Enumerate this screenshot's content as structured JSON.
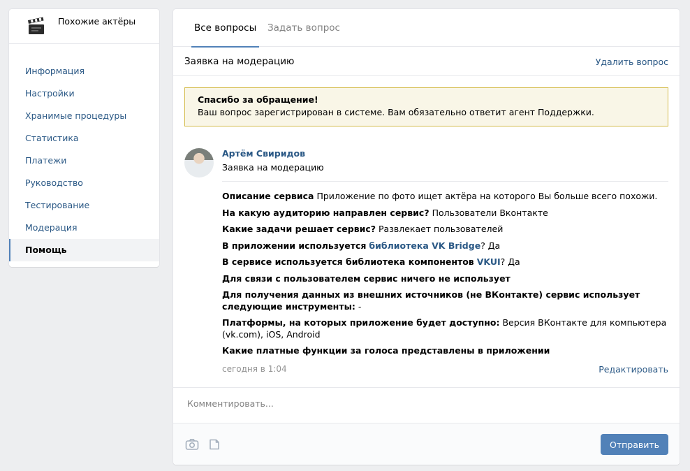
{
  "app": {
    "name": "Похожие актёры",
    "icon": "clapperboard-icon"
  },
  "sidebar": {
    "items": [
      {
        "label": "Информация"
      },
      {
        "label": "Настройки"
      },
      {
        "label": "Хранимые процедуры"
      },
      {
        "label": "Статистика"
      },
      {
        "label": "Платежи"
      },
      {
        "label": "Руководство"
      },
      {
        "label": "Тестирование"
      },
      {
        "label": "Модерация"
      },
      {
        "label": "Помощь",
        "active": true
      }
    ]
  },
  "tabs": [
    {
      "label": "Все вопросы",
      "active": true
    },
    {
      "label": "Задать вопрос"
    }
  ],
  "ticket": {
    "title": "Заявка на модерацию",
    "delete_label": "Удалить вопрос"
  },
  "notice": {
    "title": "Спасибо за обращение!",
    "text": "Ваш вопрос зарегистрирован в системе. Вам обязательно ответит агент Поддержки."
  },
  "message": {
    "author": "Артём Свиридов",
    "subject": "Заявка на модерацию",
    "fields": [
      {
        "label": "Описание сервиса",
        "value": "Приложение по фото ищет актёра на которого Вы больше всего похожи."
      },
      {
        "label": "На какую аудиторию направлен сервис?",
        "value": "Пользователи Вконтакте"
      },
      {
        "label": "Какие задачи решает сервис?",
        "value": "Развлекает пользователей"
      },
      {
        "label": "В приложении используется",
        "link": "библиотека VK Bridge",
        "value": "? Да"
      },
      {
        "label": "В сервисе используется библиотека компонентов",
        "link": "VKUI",
        "value": "? Да"
      },
      {
        "label": "Для связи с пользователем сервис ничего не использует",
        "value": ""
      },
      {
        "label": "Для получения данных из внешних источников (не ВКонтакте) сервис использует следующие инструменты:",
        "value": "-"
      },
      {
        "label": "Платформы, на которых приложение будет доступно:",
        "value": "Версия ВКонтакте для компьютера (vk.com), iOS, Android"
      },
      {
        "label": "Какие платные функции за голоса представлены в приложении",
        "value": ""
      }
    ],
    "date": "сегодня в 1:04",
    "edit_label": "Редактировать"
  },
  "comment": {
    "placeholder": "Комментировать...",
    "send_label": "Отправить",
    "tools": [
      "camera-icon",
      "document-icon"
    ]
  },
  "colors": {
    "link": "#2a5885",
    "accent": "#5181b8",
    "notice_bg": "#f9f6e7",
    "notice_border": "#d4bc4c"
  }
}
